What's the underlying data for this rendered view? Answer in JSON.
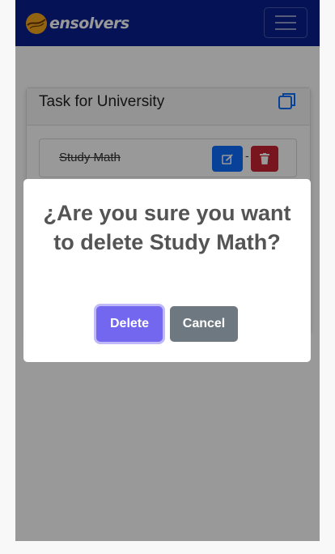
{
  "navbar": {
    "brand_text": "ensolvers",
    "brand_color": "#0a1f8f",
    "toggler_icon": "hamburger-icon"
  },
  "card": {
    "title": "Task for University",
    "copy_icon": "copy-icon",
    "tasks": [
      {
        "name": "Study Math",
        "completed": true,
        "edit_icon": "edit-icon",
        "delete_icon": "trash-icon",
        "separator": "-"
      }
    ]
  },
  "modal": {
    "title": "¿Are you sure you want to delete Study Math?",
    "confirm_label": "Delete",
    "cancel_label": "Cancel",
    "confirm_color": "#7367f0",
    "cancel_color": "#6e7881"
  }
}
